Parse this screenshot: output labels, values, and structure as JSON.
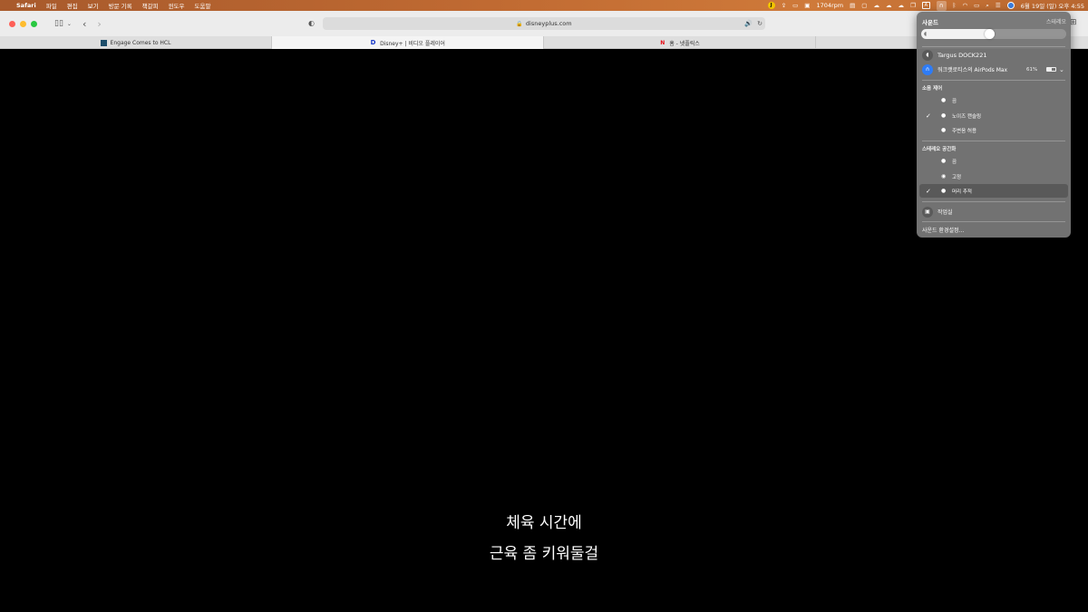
{
  "menubar": {
    "apple": "",
    "items": [
      "Safari",
      "파일",
      "편집",
      "보기",
      "방문 기록",
      "책갈피",
      "윈도우",
      "도움말"
    ],
    "status_rpm": "1704rpm",
    "status_a": "A",
    "clock": "6월 19일 (일) 오후 4:55"
  },
  "toolbar": {
    "url": "disneyplus.com"
  },
  "tabs": [
    {
      "label": "Engage Comes to HCL"
    },
    {
      "label": "Disney+ | 비디오 플레이어"
    },
    {
      "label": "홈 - 넷플릭스"
    }
  ],
  "subtitles": {
    "line1": "체육 시간에",
    "line2": "근육 좀 키워둘걸"
  },
  "sound_panel": {
    "title": "사운드",
    "stereo_label": "스테레오",
    "volume": 0.47,
    "devices": [
      {
        "name": "Targus DOCK221"
      },
      {
        "name": "워크랫로티스의 AirPods Max",
        "battery": "61%"
      }
    ],
    "noise_control": {
      "title": "소음 제어",
      "options": [
        "끔",
        "노이즈 캔슬링",
        "주변음 허용"
      ],
      "selected": 1
    },
    "spatial_audio": {
      "title": "스테레오 공간화",
      "options": [
        "끔",
        "고정",
        "머리 추적"
      ],
      "selected": 2
    },
    "studio": "작업실",
    "settings": "사운드 환경설정..."
  },
  "colors": {
    "menubar": "#c06a32",
    "accent_blue": "#2e7cf6",
    "netflix_red": "#e50914"
  }
}
